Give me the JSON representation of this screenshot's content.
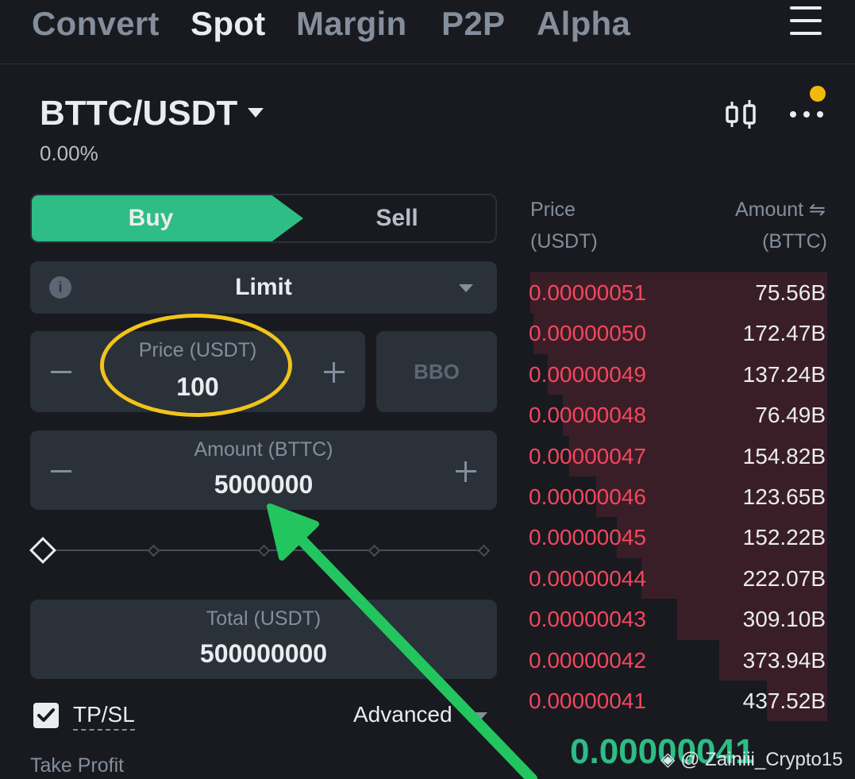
{
  "nav": {
    "tabs": [
      {
        "label": "Convert",
        "active": false
      },
      {
        "label": "Spot",
        "active": true
      },
      {
        "label": "Margin",
        "active": false
      },
      {
        "label": "P2P",
        "active": false
      },
      {
        "label": "Alpha",
        "active": false
      }
    ],
    "menu_icon": "hamburger-menu-icon"
  },
  "header": {
    "pair": "BTTC/USDT",
    "change": "0.00%",
    "chart_icon": "candlestick-chart-icon",
    "more_icon": "more-dots-icon",
    "notification_color": "#f0b90b"
  },
  "order_form": {
    "side_buy": "Buy",
    "side_sell": "Sell",
    "order_type": "Limit",
    "price_label": "Price (USDT)",
    "price_value": "100",
    "bbo_label": "BBO",
    "amount_label": "Amount (BTTC)",
    "amount_value": "5000000",
    "slider_percent": 0,
    "total_label": "Total (USDT)",
    "total_value": "500000000",
    "tpsl_label": "TP/SL",
    "tpsl_checked": true,
    "advanced_label": "Advanced",
    "take_profit_label": "Take Profit"
  },
  "order_book": {
    "price_header": "Price",
    "price_unit": "(USDT)",
    "amount_header": "Amount ⇋",
    "amount_unit": "(BTTC)",
    "asks": [
      {
        "price": "0.00000051",
        "amount": "75.56B",
        "depth": 0.99
      },
      {
        "price": "0.00000050",
        "amount": "172.47B",
        "depth": 0.98
      },
      {
        "price": "0.00000049",
        "amount": "137.24B",
        "depth": 0.93
      },
      {
        "price": "0.00000048",
        "amount": "76.49B",
        "depth": 0.88
      },
      {
        "price": "0.00000047",
        "amount": "154.82B",
        "depth": 0.86
      },
      {
        "price": "0.00000046",
        "amount": "123.65B",
        "depth": 0.77
      },
      {
        "price": "0.00000045",
        "amount": "152.22B",
        "depth": 0.7
      },
      {
        "price": "0.00000044",
        "amount": "222.07B",
        "depth": 0.62
      },
      {
        "price": "0.00000043",
        "amount": "309.10B",
        "depth": 0.5
      },
      {
        "price": "0.00000042",
        "amount": "373.94B",
        "depth": 0.36
      },
      {
        "price": "0.00000041",
        "amount": "437.52B",
        "depth": 0.2
      }
    ],
    "last_price": "0.00000041",
    "ask_color": "#f6465d",
    "bid_color": "#2ebd85"
  },
  "watermark": "@ Zainiii_Crypto15",
  "watermark_icon": "binance-logo-icon",
  "annotations": {
    "ring_color": "#f0c419",
    "arrow_color": "#22c55e"
  }
}
